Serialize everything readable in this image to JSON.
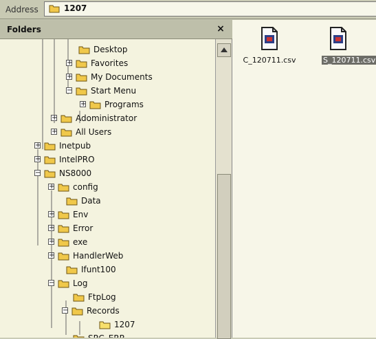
{
  "address": {
    "label": "Address",
    "value": "1207"
  },
  "folders_pane": {
    "title": "Folders",
    "close_icon": "×"
  },
  "tree": [
    {
      "label": "Desktop",
      "expand": "",
      "sel": false
    },
    {
      "label": "Favorites",
      "expand": "+",
      "sel": false
    },
    {
      "label": "My Documents",
      "expand": "+",
      "sel": false
    },
    {
      "label": "Start Menu",
      "expand": "−",
      "sel": false
    },
    {
      "label": "Programs",
      "expand": "+",
      "sel": false
    },
    {
      "label": "Adoministrator",
      "expand": "+",
      "sel": false
    },
    {
      "label": "All Users",
      "expand": "+",
      "sel": false
    },
    {
      "label": "Inetpub",
      "expand": "+",
      "sel": false
    },
    {
      "label": "IntelPRO",
      "expand": "+",
      "sel": false
    },
    {
      "label": "NS8000",
      "expand": "−",
      "sel": false
    },
    {
      "label": "config",
      "expand": "+",
      "sel": false
    },
    {
      "label": "Data",
      "expand": "",
      "sel": false
    },
    {
      "label": "Env",
      "expand": "+",
      "sel": false
    },
    {
      "label": "Error",
      "expand": "+",
      "sel": false
    },
    {
      "label": "exe",
      "expand": "+",
      "sel": false
    },
    {
      "label": "HandlerWeb",
      "expand": "+",
      "sel": false
    },
    {
      "label": "Ifunt100",
      "expand": "",
      "sel": false
    },
    {
      "label": "Log",
      "expand": "−",
      "sel": false
    },
    {
      "label": "FtpLog",
      "expand": "",
      "sel": false
    },
    {
      "label": "Records",
      "expand": "−",
      "sel": false
    },
    {
      "label": "1207",
      "expand": "",
      "sel": true
    },
    {
      "label": "SRC_ERR",
      "expand": "",
      "sel": false
    }
  ],
  "files": [
    {
      "name": "C_120711.csv",
      "selected": false
    },
    {
      "name": "S_120711.csv",
      "selected": true
    }
  ]
}
